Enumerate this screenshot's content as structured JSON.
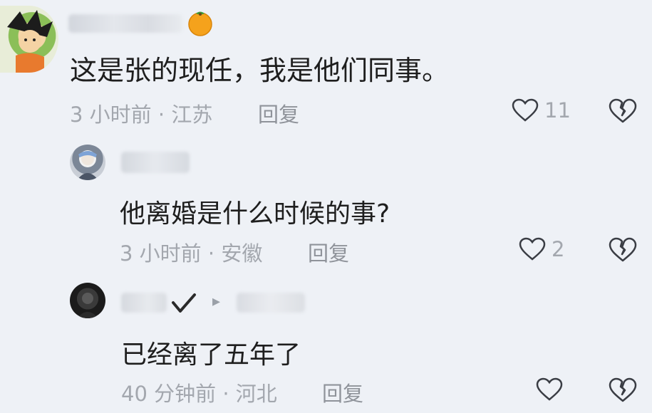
{
  "comments": [
    {
      "text": "这是张的现任，我是他们同事。",
      "time": "3 小时前 · 江苏",
      "reply": "回复",
      "likes": "11",
      "user_badge": "tangerine-emoji"
    },
    {
      "text": "他离婚是什么时候的事?",
      "time": "3 小时前 · 安徽",
      "reply": "回复",
      "likes": "2"
    },
    {
      "text": "已经离了五年了",
      "time": "40 分钟前 · 河北",
      "reply": "回复",
      "likes": "",
      "reply_indicator": "▸"
    }
  ],
  "icons": {
    "like": "heart-outline-icon",
    "dislike": "broken-heart-icon"
  },
  "colors": {
    "background": "#eef1f6",
    "text": "#1e1e1e",
    "meta": "#a3a7ae"
  }
}
